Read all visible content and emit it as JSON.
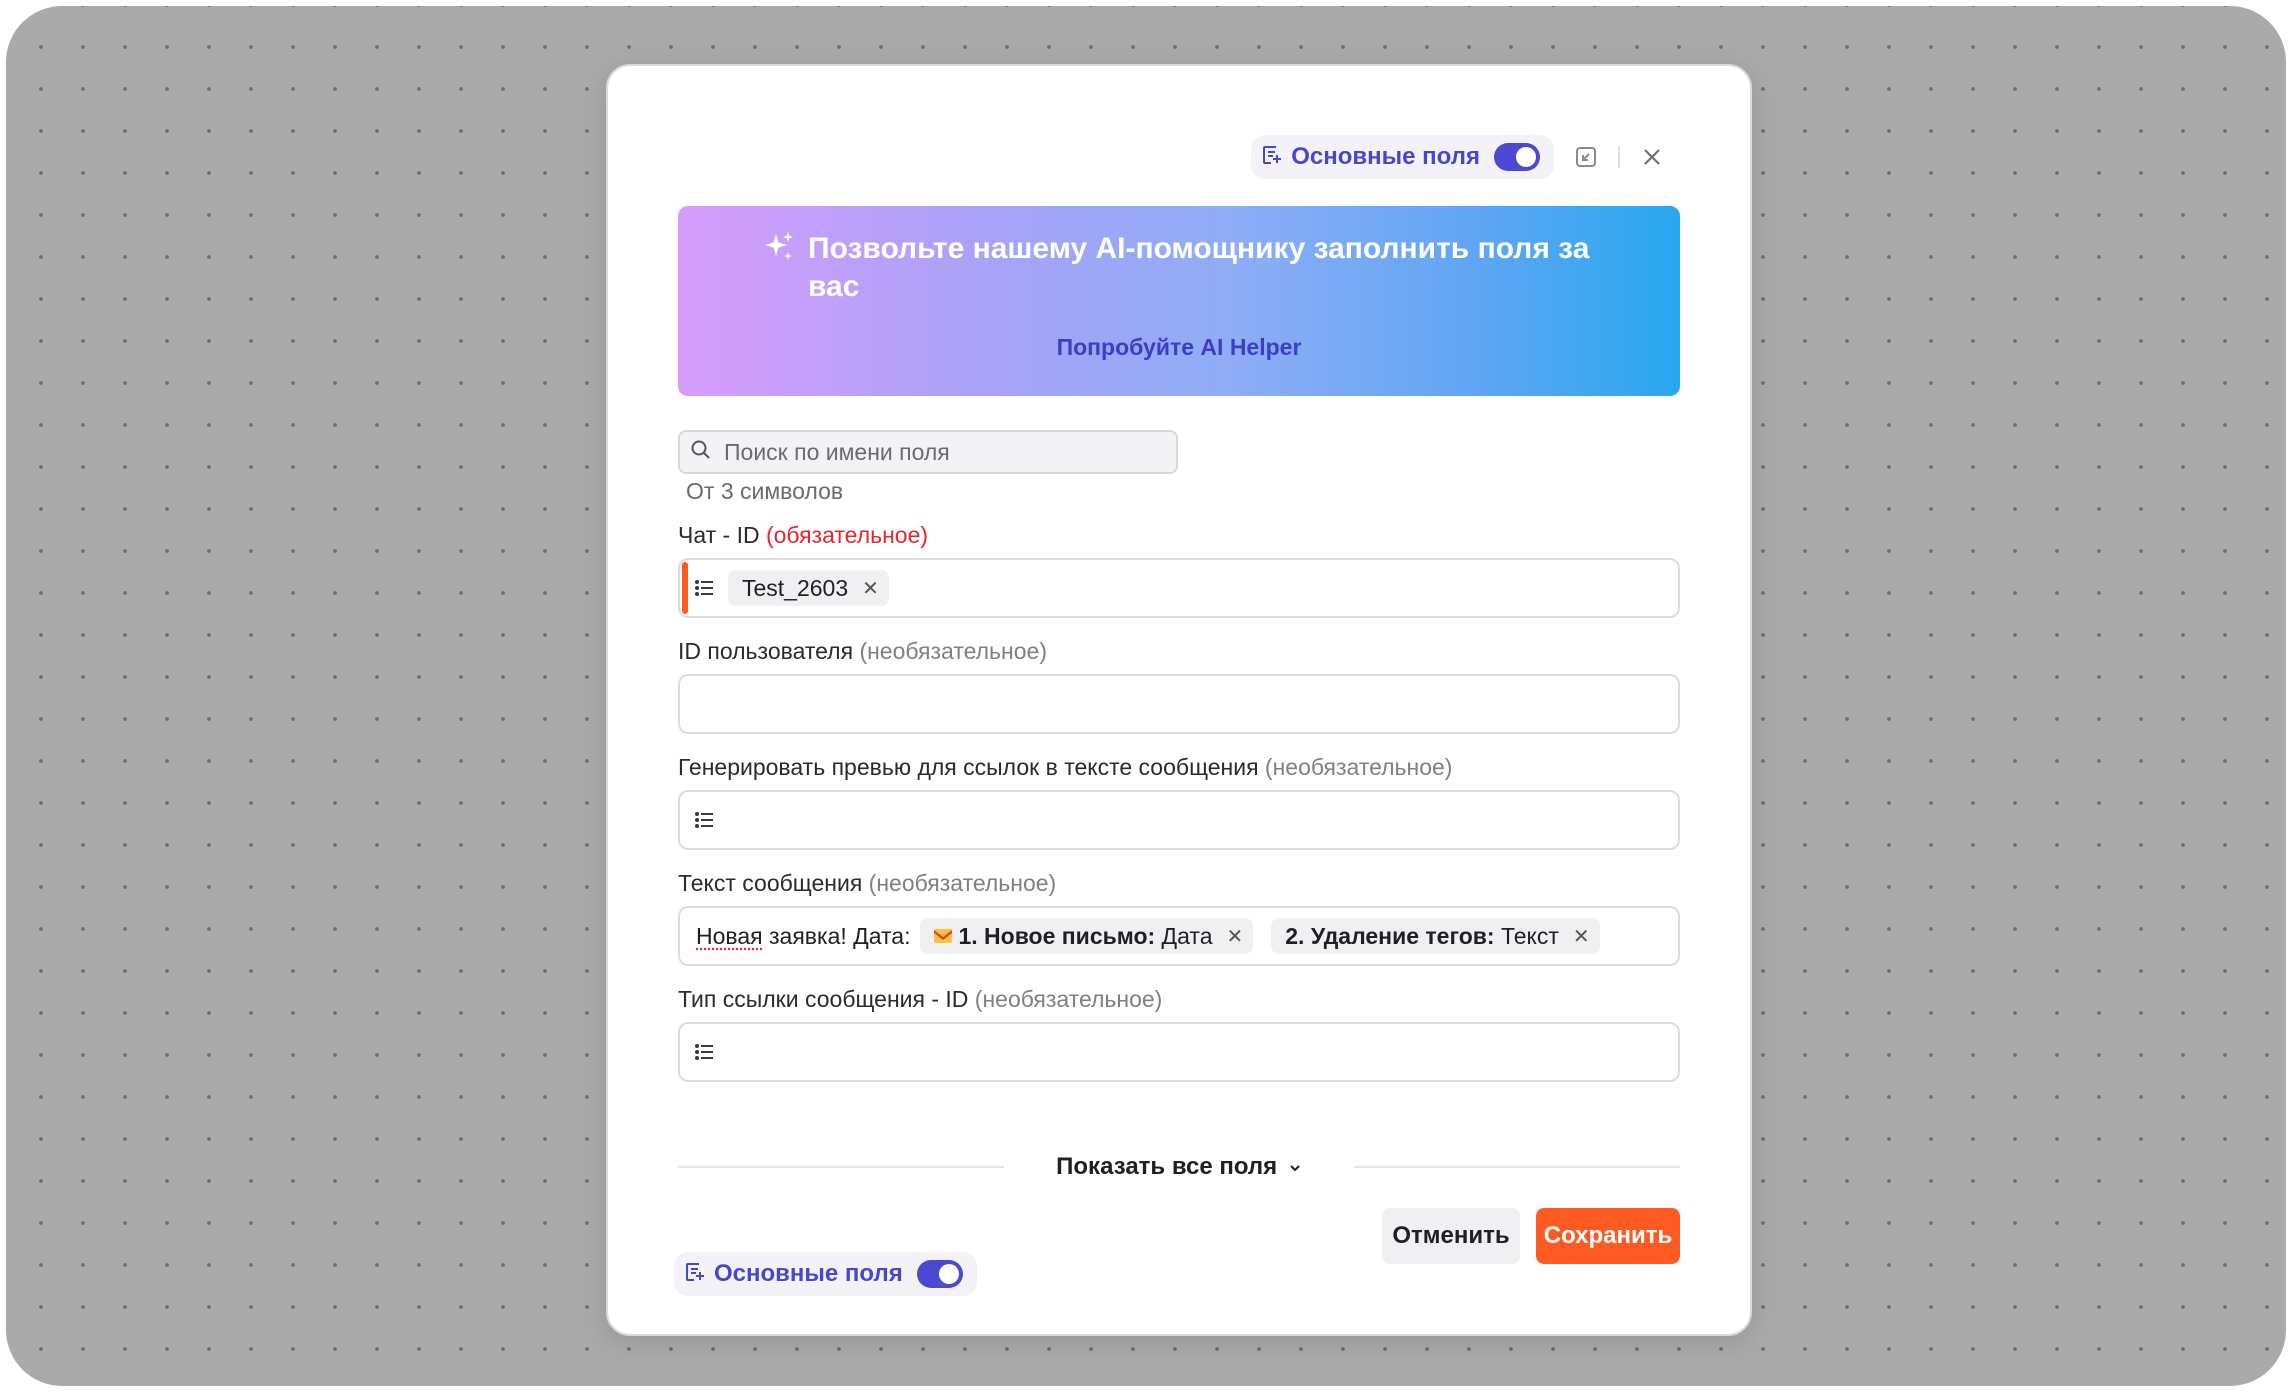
{
  "modal": {
    "header": {
      "fields_toggle_label": "Основные поля",
      "fields_toggle_on": true
    },
    "ai_banner": {
      "title": "Позвольте нашему AI-помощнику заполнить поля за вас",
      "cta": "Попробуйте AI Helper"
    },
    "search": {
      "placeholder": "Поиск по имени поля",
      "hint": "От 3 символов"
    },
    "fields": [
      {
        "label": "Чат - ID",
        "qualifier": "(обязательное)",
        "required": true,
        "chips": [
          "Test_2603"
        ]
      },
      {
        "label": "ID пользователя",
        "qualifier": "(необязательное)",
        "required": false
      },
      {
        "label": "Генерировать превью для ссылок в тексте сообщения",
        "qualifier": "(необязательное)",
        "required": false
      },
      {
        "label": "Текст сообщения",
        "qualifier": "(необязательное)",
        "required": false,
        "text_prefix_word": "Новая",
        "text_prefix_rest": " заявка! Дата:",
        "chips": [
          {
            "bold": "1. Новое письмо:",
            "rest": " Дата",
            "icon": "gmail-icon"
          },
          {
            "bold": "2. Удаление тегов:",
            "rest": " Текст"
          }
        ]
      },
      {
        "label": "Тип ссылки сообщения - ID",
        "qualifier": "(необязательное)",
        "required": false
      }
    ],
    "show_all_fields": "Показать все поля",
    "footer": {
      "fields_toggle_label": "Основные поля",
      "fields_toggle_on": true,
      "cancel": "Отменить",
      "save": "Сохранить"
    }
  },
  "colors": {
    "accent": "#4b48d1",
    "primary_button": "#ff5a24",
    "required": "#e6262e"
  }
}
